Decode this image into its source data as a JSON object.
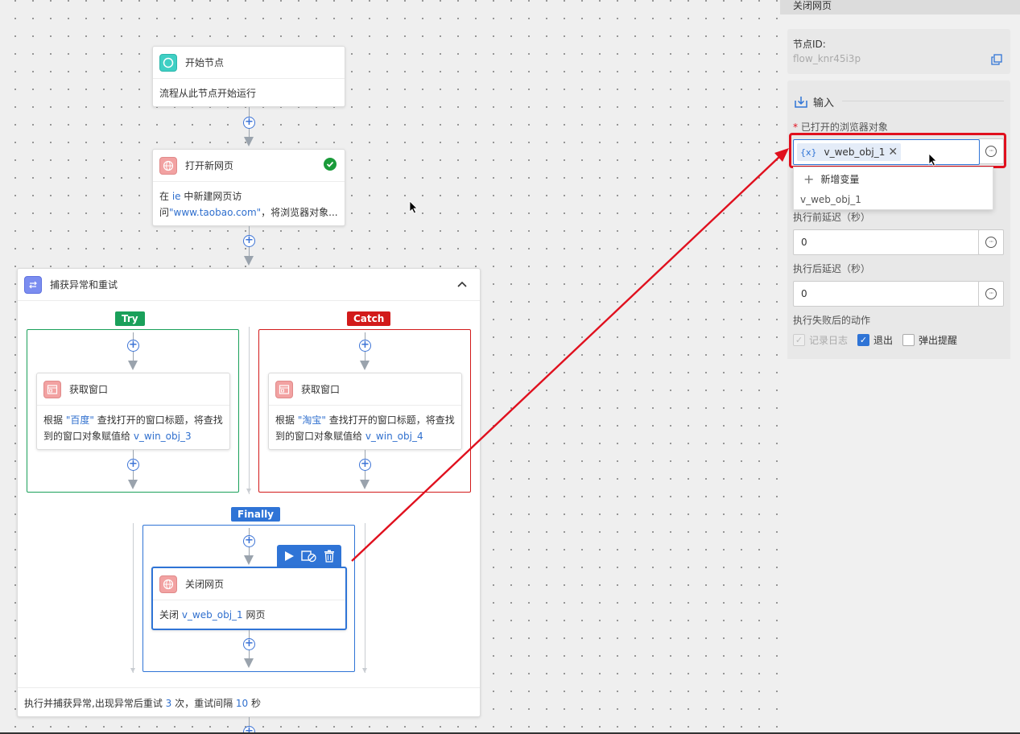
{
  "flow": {
    "start_node": {
      "title": "开始节点",
      "desc": "流程从此节点开始运行"
    },
    "open_page_node": {
      "title": "打开新网页",
      "desc_pre": "在 ",
      "desc_hl1": "ie",
      "desc_mid": " 中新建网页访",
      "desc_line2_pre": "问",
      "desc_hl2": "\"www.taobao.com\"",
      "desc_line2_post": "，将浏览器对象..."
    },
    "try_catch": {
      "title": "捕获异常和重试",
      "try_label": "Try",
      "catch_label": "Catch",
      "finally_label": "Finally",
      "try_node": {
        "title": "获取窗口",
        "l1_pre": "根据 ",
        "l1_hl": "\"百度\"",
        "l1_post": " 查找打开的窗口标题，将查找",
        "l2_pre": "到的窗口对象赋值给 ",
        "l2_hl": "v_win_obj_3"
      },
      "catch_node": {
        "title": "获取窗口",
        "l1_pre": "根据 ",
        "l1_hl": "\"淘宝\"",
        "l1_post": " 查找打开的窗口标题，将查找",
        "l2_pre": "到的窗口对象赋值给 ",
        "l2_hl": "v_win_obj_4"
      },
      "finally_node": {
        "title": "关闭网页",
        "desc_pre": "关闭 ",
        "desc_hl": "v_web_obj_1",
        "desc_post": " 网页"
      },
      "footer_pre": "执行并捕获异常,出现异常后重试 ",
      "footer_n1": "3",
      "footer_mid": " 次，重试间隔 ",
      "footer_n2": "10",
      "footer_post": " 秒"
    }
  },
  "panel": {
    "header_title": "关闭网页",
    "node_id_label": "节点ID:",
    "node_id_value": "flow_knr45i3p",
    "input_section": "输入",
    "browser_label": "已打开的浏览器对象",
    "required_mark": "*",
    "var_badge": "{x}",
    "var_value": "v_web_obj_1",
    "dropdown_items": [
      "新增变量",
      "v_web_obj_1"
    ],
    "pre_delay_label": "执行前延迟（秒）",
    "pre_delay_value": "0",
    "post_delay_label": "执行后延迟（秒）",
    "post_delay_value": "0",
    "fail_action_label": "执行失败后的动作",
    "checkboxes": [
      {
        "label": "记录日志",
        "checked": true,
        "disabled": true
      },
      {
        "label": "退出",
        "checked": true,
        "disabled": false
      },
      {
        "label": "弹出提醒",
        "checked": false,
        "disabled": false
      }
    ]
  },
  "colors": {
    "try": "#1aa05a",
    "catch": "#d21a1a",
    "finally": "#2f74d6",
    "highlight": "#2f6fce",
    "annotation": "#e0101e"
  }
}
